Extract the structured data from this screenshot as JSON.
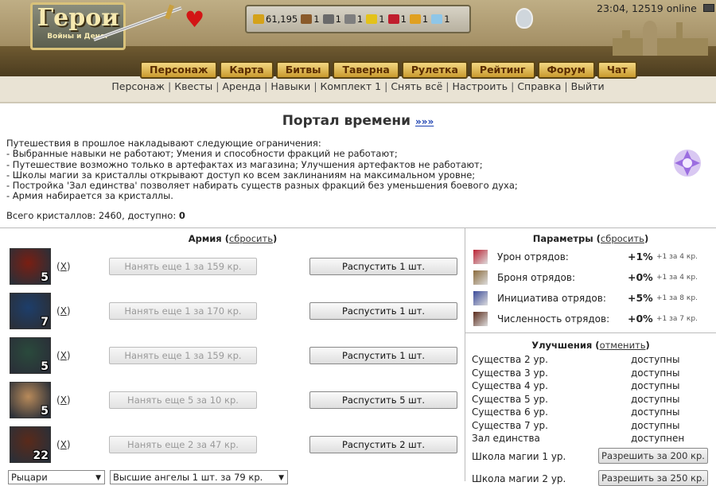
{
  "logo": {
    "title": "Герои",
    "subtitle": "Войны и Денег"
  },
  "resources": [
    {
      "icon": "gold-icon",
      "value": "61,195",
      "color": "#d4a21a"
    },
    {
      "icon": "wood-icon",
      "value": "1",
      "color": "#8a5a2a"
    },
    {
      "icon": "ore-icon",
      "value": "1",
      "color": "#6a6a6a"
    },
    {
      "icon": "mercury-icon",
      "value": "1",
      "color": "#7f7f7f"
    },
    {
      "icon": "sulfur-icon",
      "value": "1",
      "color": "#e3c21a"
    },
    {
      "icon": "crystal-icon",
      "value": "1",
      "color": "#c01e2e"
    },
    {
      "icon": "gems-icon",
      "value": "1",
      "color": "#e0a020"
    },
    {
      "icon": "diamond-icon",
      "value": "1",
      "color": "#8ec6e8"
    }
  ],
  "clock": "23:04, 12519 online",
  "nav_tabs": [
    "Персонаж",
    "Карта",
    "Битвы",
    "Таверна",
    "Рулетка",
    "Рейтинг",
    "Форум",
    "Чат"
  ],
  "subnav": [
    "Персонаж",
    "Квесты",
    "Аренда",
    "Навыки",
    "Комплект 1",
    "Снять всё",
    "Настроить",
    "Справка",
    "Выйти"
  ],
  "portal": {
    "title": "Портал времени",
    "more": "»»»",
    "restrictions": [
      "Путешествия в прошлое накладывают следующие ограничения:",
      "- Выбранные навыки не работают; Умения и способности фракций не работают;",
      "- Путешествие возможно только в артефактах из магазина; Улучшения артефактов не работают;",
      "- Школы магии за кристаллы открывают доступ ко всем заклинаниям на максимальном уровне;",
      "- Постройка 'Зал единства' позволяет набирать существ разных фракций без уменьшения боевого духа;",
      "- Армия набирается за кристаллы."
    ],
    "crystals_label": "Всего кристаллов: 2460, доступно: ",
    "crystals_available": "0"
  },
  "army": {
    "title": "Армия",
    "reset": "сбросить",
    "remove_label": "X",
    "units": [
      {
        "count": "5",
        "hire": "Нанять еще 1 за 159 кр.",
        "dismiss": "Распустить 1 шт.",
        "color": "#7a1e12"
      },
      {
        "count": "7",
        "hire": "Нанять еще 1 за 170 кр.",
        "dismiss": "Распустить 1 шт.",
        "color": "#1d3e6b"
      },
      {
        "count": "5",
        "hire": "Нанять еще 1 за 159 кр.",
        "dismiss": "Распустить 1 шт.",
        "color": "#2a4a3c"
      },
      {
        "count": "5",
        "hire": "Нанять еще 5 за 10 кр.",
        "dismiss": "Распустить 5 шт.",
        "color": "#b88a5a"
      },
      {
        "count": "22",
        "hire": "Нанять еще 2 за 47 кр.",
        "dismiss": "Распустить 2 шт.",
        "color": "#5a2a1a"
      }
    ],
    "faction_select": "Рыцари",
    "hire_select": "Высшие ангелы 1 шт. за 79 кр."
  },
  "params": {
    "title": "Параметры",
    "reset": "сбросить",
    "rows": [
      {
        "icon": "damage-icon",
        "label": "Урон отрядов:",
        "value": "+1%",
        "cost": "+1 за 4 кр."
      },
      {
        "icon": "armor-icon",
        "label": "Броня отрядов:",
        "value": "+0%",
        "cost": "+1 за 4 кр."
      },
      {
        "icon": "initiative-icon",
        "label": "Инициатива отрядов:",
        "value": "+5%",
        "cost": "+1 за 8 кр."
      },
      {
        "icon": "population-icon",
        "label": "Численность отрядов:",
        "value": "+0%",
        "cost": "+1 за 7 кр."
      }
    ]
  },
  "upgrades": {
    "title": "Улучшения",
    "reset": "отменить",
    "rows": [
      {
        "label": "Существа 2 ур.",
        "status": "доступны"
      },
      {
        "label": "Существа 3 ур.",
        "status": "доступны"
      },
      {
        "label": "Существа 4 ур.",
        "status": "доступны"
      },
      {
        "label": "Существа 5 ур.",
        "status": "доступны"
      },
      {
        "label": "Существа 6 ур.",
        "status": "доступны"
      },
      {
        "label": "Существа 7 ур.",
        "status": "доступны"
      },
      {
        "label": "Зал единства",
        "status": "доступнен"
      }
    ],
    "buy_rows": [
      {
        "label": "Школа магии 1 ур.",
        "button": "Разрешить за 200 кр."
      },
      {
        "label": "Школа магии 2 ур.",
        "button": "Разрешить за 250 кр."
      }
    ]
  }
}
